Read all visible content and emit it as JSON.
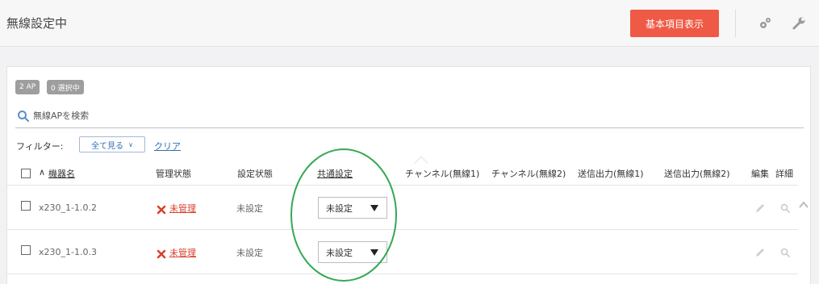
{
  "header": {
    "title": "無線設定中",
    "primary_button": "基本項目表示",
    "icons": [
      "gears-icon",
      "wrench-icon"
    ]
  },
  "badges": {
    "ap_count": "2 AP",
    "selected": "0 選択中"
  },
  "search": {
    "placeholder": "無線APを検索",
    "value": ""
  },
  "filter": {
    "label": "フィルター:",
    "selected": "全て見る",
    "clear": "クリア"
  },
  "table": {
    "sort_indicator": "∧",
    "columns": {
      "device_name": "機器名",
      "mgmt_status": "管理状態",
      "config_status": "設定状態",
      "common_config": "共通設定",
      "channel_1": "チャンネル(無線1)",
      "channel_2": "チャンネル(無線2)",
      "tx_power_1": "送信出力(無線1)",
      "tx_power_2": "送信出力(無線2)",
      "edit": "編集",
      "details": "詳細"
    },
    "rows": [
      {
        "device_name": "x230_1-1.0.2",
        "mgmt_status": "未管理",
        "config_status": "未設定",
        "common_config": "未設定"
      },
      {
        "device_name": "x230_1-1.0.3",
        "mgmt_status": "未管理",
        "config_status": "未設定",
        "common_config": "未設定"
      }
    ]
  },
  "colors": {
    "accent": "#ee5a45",
    "link": "#2f6eb5",
    "error": "#d9402c",
    "highlight": "#34a853"
  }
}
